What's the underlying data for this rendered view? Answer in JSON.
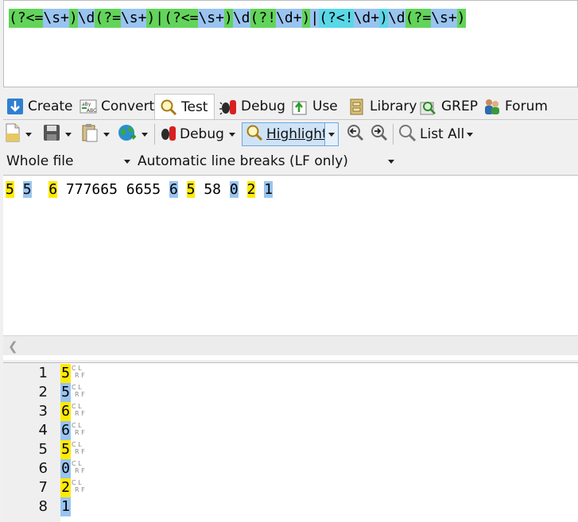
{
  "regex": {
    "tokens": [
      {
        "text": "(?<=",
        "class": "hg"
      },
      {
        "text": "\\s+",
        "class": "hb"
      },
      {
        "text": ")",
        "class": "hg"
      },
      {
        "text": "\\d",
        "class": "hb"
      },
      {
        "text": "(?=",
        "class": "hg"
      },
      {
        "text": "\\s+",
        "class": "hb"
      },
      {
        "text": ")|(?<=",
        "class": "hg"
      },
      {
        "text": "\\s+",
        "class": "hb"
      },
      {
        "text": ")",
        "class": "hg"
      },
      {
        "text": "\\d",
        "class": "hb"
      },
      {
        "text": "(?!",
        "class": "hg"
      },
      {
        "text": "\\d+",
        "class": "hb"
      },
      {
        "text": ")",
        "class": "hg"
      },
      {
        "text": "|",
        "class": "hb"
      },
      {
        "text": "(?<!",
        "class": "hc"
      },
      {
        "text": "\\d+",
        "class": "hb"
      },
      {
        "text": ")",
        "class": "hc"
      },
      {
        "text": "\\d",
        "class": "hb"
      },
      {
        "text": "(?=",
        "class": "hg"
      },
      {
        "text": "\\s+",
        "class": "hb"
      },
      {
        "text": ")",
        "class": "hg"
      }
    ]
  },
  "tabs": {
    "create": "Create",
    "convert": "Convert",
    "test": "Test",
    "debug": "Debug",
    "use": "Use",
    "library": "Library",
    "grep": "GREP",
    "forum": "Forum"
  },
  "toolbar": {
    "debug_label": "Debug",
    "highlight_label": "Highlight",
    "list_all_label": "List All"
  },
  "options": {
    "scope": "Whole file",
    "line_breaks": "Automatic line breaks (LF only)"
  },
  "subject": {
    "tokens": [
      {
        "text": "5",
        "class": "hy"
      },
      {
        "text": " ",
        "class": ""
      },
      {
        "text": "5",
        "class": "hb"
      },
      {
        "text": "  ",
        "class": ""
      },
      {
        "text": "6",
        "class": "hy"
      },
      {
        "text": " 777665 6655 ",
        "class": ""
      },
      {
        "text": "6",
        "class": "hb"
      },
      {
        "text": " ",
        "class": ""
      },
      {
        "text": "5",
        "class": "hy"
      },
      {
        "text": " 58 ",
        "class": ""
      },
      {
        "text": "0",
        "class": "hb"
      },
      {
        "text": " ",
        "class": ""
      },
      {
        "text": "2",
        "class": "hy"
      },
      {
        "text": " ",
        "class": ""
      },
      {
        "text": "1",
        "class": "hb"
      }
    ]
  },
  "results": {
    "rows": [
      {
        "num": "1",
        "value": "5",
        "class": "hy",
        "break_top": "C L",
        "break_bottom": "R F"
      },
      {
        "num": "2",
        "value": "5",
        "class": "hb",
        "break_top": "C L",
        "break_bottom": "R F"
      },
      {
        "num": "3",
        "value": "6",
        "class": "hy",
        "break_top": "C L",
        "break_bottom": "R F"
      },
      {
        "num": "4",
        "value": "6",
        "class": "hb",
        "break_top": "C L",
        "break_bottom": "R F"
      },
      {
        "num": "5",
        "value": "5",
        "class": "hy",
        "break_top": "C L",
        "break_bottom": "R F"
      },
      {
        "num": "6",
        "value": "0",
        "class": "hb",
        "break_top": "C L",
        "break_bottom": "R F"
      },
      {
        "num": "7",
        "value": "2",
        "class": "hy",
        "break_top": "C L",
        "break_bottom": "R F"
      },
      {
        "num": "8",
        "value": "1",
        "class": "hb",
        "break_top": "",
        "break_bottom": ""
      }
    ]
  }
}
